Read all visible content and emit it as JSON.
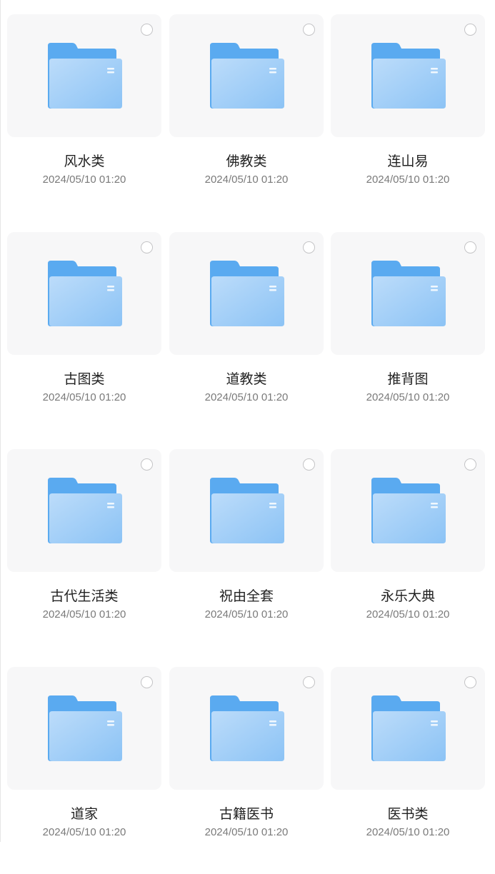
{
  "folders": [
    {
      "name": "风水类",
      "date": "2024/05/10 01:20"
    },
    {
      "name": "佛教类",
      "date": "2024/05/10 01:20"
    },
    {
      "name": "连山易",
      "date": "2024/05/10 01:20"
    },
    {
      "name": "古图类",
      "date": "2024/05/10 01:20"
    },
    {
      "name": "道教类",
      "date": "2024/05/10 01:20"
    },
    {
      "name": "推背图",
      "date": "2024/05/10 01:20"
    },
    {
      "name": "古代生活类",
      "date": "2024/05/10 01:20"
    },
    {
      "name": "祝由全套",
      "date": "2024/05/10 01:20"
    },
    {
      "name": "永乐大典",
      "date": "2024/05/10 01:20"
    },
    {
      "name": "道家",
      "date": "2024/05/10 01:20"
    },
    {
      "name": "古籍医书",
      "date": "2024/05/10 01:20"
    },
    {
      "name": "医书类",
      "date": "2024/05/10 01:20"
    }
  ],
  "colors": {
    "folder_back": "#5aaaf0",
    "folder_front_top": "#bcdcfa",
    "folder_front_bottom": "#8cc3f5",
    "tile_background": "#f7f7f8"
  },
  "icons": {
    "folder": "folder-icon",
    "select": "select-circle-icon"
  }
}
